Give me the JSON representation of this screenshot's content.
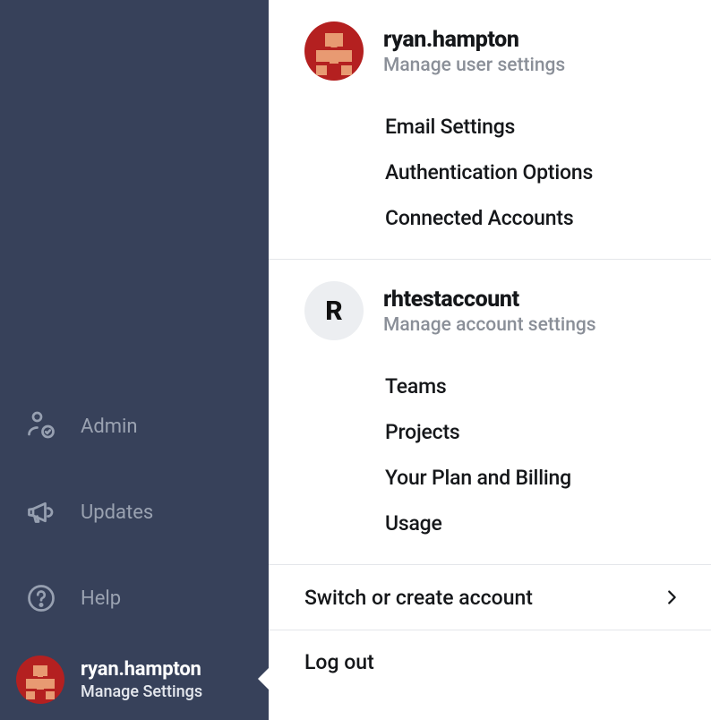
{
  "sidebar": {
    "items": [
      {
        "label": "Admin"
      },
      {
        "label": "Updates"
      },
      {
        "label": "Help"
      }
    ],
    "profile": {
      "name": "ryan.hampton",
      "subtitle": "Manage Settings"
    }
  },
  "flyout": {
    "user": {
      "name": "ryan.hampton",
      "subtitle": "Manage user settings",
      "links": [
        "Email Settings",
        "Authentication Options",
        "Connected Accounts"
      ]
    },
    "account": {
      "initial": "R",
      "name": "rhtestaccount",
      "subtitle": "Manage account settings",
      "links": [
        "Teams",
        "Projects",
        "Your Plan and Billing",
        "Usage"
      ]
    },
    "switch_label": "Switch or create account",
    "logout_label": "Log out"
  },
  "colors": {
    "sidebar_bg": "#37415a",
    "text_muted": "#8a8f98",
    "avatar_bg": "#b42020",
    "avatar_fg": "#e89a72"
  }
}
